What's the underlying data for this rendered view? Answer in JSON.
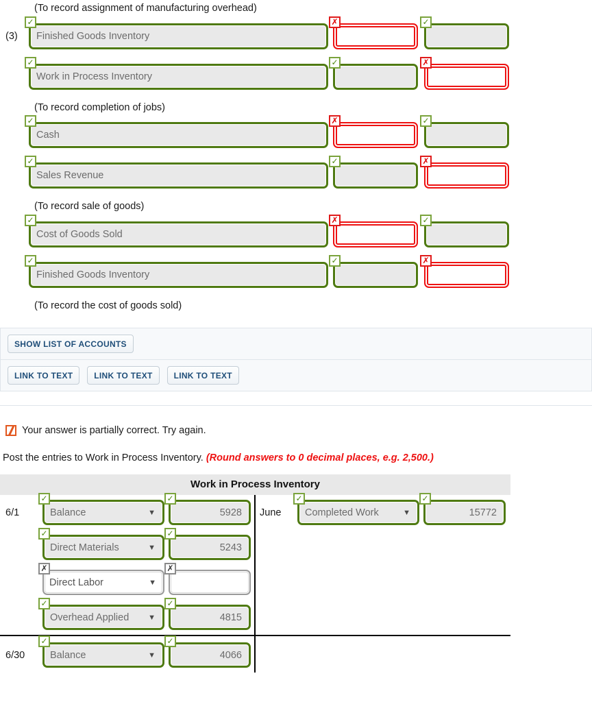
{
  "journal": {
    "memo_overhead": "(To record assignment of manufacturing overhead)",
    "memo_completion": "(To record completion of jobs)",
    "memo_sale": "(To record sale of goods)",
    "memo_cogs": "(To record the cost of goods sold)",
    "entry_number": "(3)",
    "rows": [
      {
        "account": "Finished Goods Inventory",
        "account_status": "check",
        "debit": "",
        "debit_status": "x",
        "credit": "",
        "credit_status": "check"
      },
      {
        "account": "Work in Process Inventory",
        "account_status": "check",
        "debit": "",
        "debit_status": "check",
        "credit": "",
        "credit_status": "x"
      },
      {
        "account": "Cash",
        "account_status": "check",
        "debit": "",
        "debit_status": "x",
        "credit": "",
        "credit_status": "check"
      },
      {
        "account": "Sales Revenue",
        "account_status": "check",
        "debit": "",
        "debit_status": "check",
        "credit": "",
        "credit_status": "x"
      },
      {
        "account": "Cost of Goods Sold",
        "account_status": "check",
        "debit": "",
        "debit_status": "x",
        "credit": "",
        "credit_status": "check"
      },
      {
        "account": "Finished Goods Inventory",
        "account_status": "check",
        "debit": "",
        "debit_status": "check",
        "credit": "",
        "credit_status": "x"
      }
    ]
  },
  "toolbar": {
    "show_list_label": "SHOW LIST OF ACCOUNTS",
    "link_to_text_1": "LINK TO TEXT",
    "link_to_text_2": "LINK TO TEXT",
    "link_to_text_3": "LINK TO TEXT"
  },
  "feedback": {
    "icon": "partial-correct-icon",
    "message": "Your answer is partially correct.  Try again."
  },
  "prompt": {
    "text": "Post the entries to Work in Process Inventory. ",
    "hint": "(Round answers to 0 decimal places, e.g. 2,500.)"
  },
  "t_account": {
    "title": "Work in Process Inventory",
    "left": [
      {
        "date": "6/1",
        "name": "Balance",
        "name_status": "check",
        "amount": "5928",
        "amount_status": "check"
      },
      {
        "date": "",
        "name": "Direct Materials",
        "name_status": "check",
        "amount": "5243",
        "amount_status": "check"
      },
      {
        "date": "",
        "name": "Direct Labor",
        "name_status": "gray-x",
        "amount": "",
        "amount_status": "gray-x"
      },
      {
        "date": "",
        "name": "Overhead Applied",
        "name_status": "check",
        "amount": "4815",
        "amount_status": "check"
      },
      {
        "date": "6/30",
        "name": "Balance",
        "name_status": "check",
        "amount": "4066",
        "amount_status": "check"
      }
    ],
    "right": [
      {
        "date": "June",
        "name": "Completed Work",
        "name_status": "check",
        "amount": "15772",
        "amount_status": "check"
      }
    ],
    "caret_glyph": "▼"
  },
  "colors": {
    "correct_green": "#4f7a12",
    "incorrect_red": "#ee1111",
    "neutral_gray": "#9a9a9a",
    "hint_red": "#ee1111",
    "button_text": "#1f4e79",
    "header_gray": "#e8e8e8"
  }
}
